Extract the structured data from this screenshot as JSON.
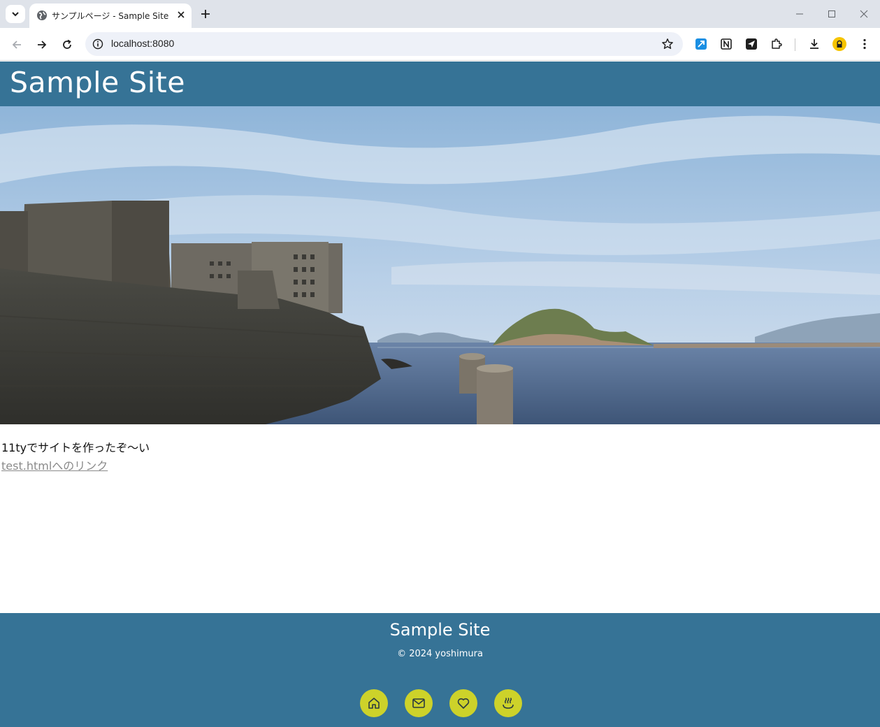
{
  "browser": {
    "tab_title": "サンプルページ - Sample Site",
    "url": "localhost:8080"
  },
  "icons": {
    "tab_search": "chevron-down-icon",
    "favicon": "globe-icon",
    "close": "close-icon",
    "new_tab": "plus-icon",
    "back": "back-arrow-icon",
    "forward": "forward-arrow-icon",
    "reload": "reload-icon",
    "site_info": "info-icon",
    "bookmark": "star-icon",
    "extensions": [
      "send-arrow-icon",
      "notion-icon",
      "paper-plane-icon",
      "puzzle-icon"
    ],
    "downloads": "download-icon",
    "profile": "profile-avatar-icon",
    "menu": "kebab-menu-icon",
    "footer": [
      "home-icon",
      "mail-icon",
      "heart-icon",
      "hot-spring-icon"
    ]
  },
  "colors": {
    "header_bg": "#367396",
    "footer_bg": "#367396",
    "footer_button_bg": "#cdd22a",
    "link": "#8a8a8a"
  },
  "page": {
    "site_title": "Sample Site",
    "lead_text": "11tyでサイトを作ったぞ〜い",
    "link_text": "test.htmlへのリンク"
  },
  "footer": {
    "title": "Sample Site",
    "copyright": "© 2024 yoshimura"
  }
}
